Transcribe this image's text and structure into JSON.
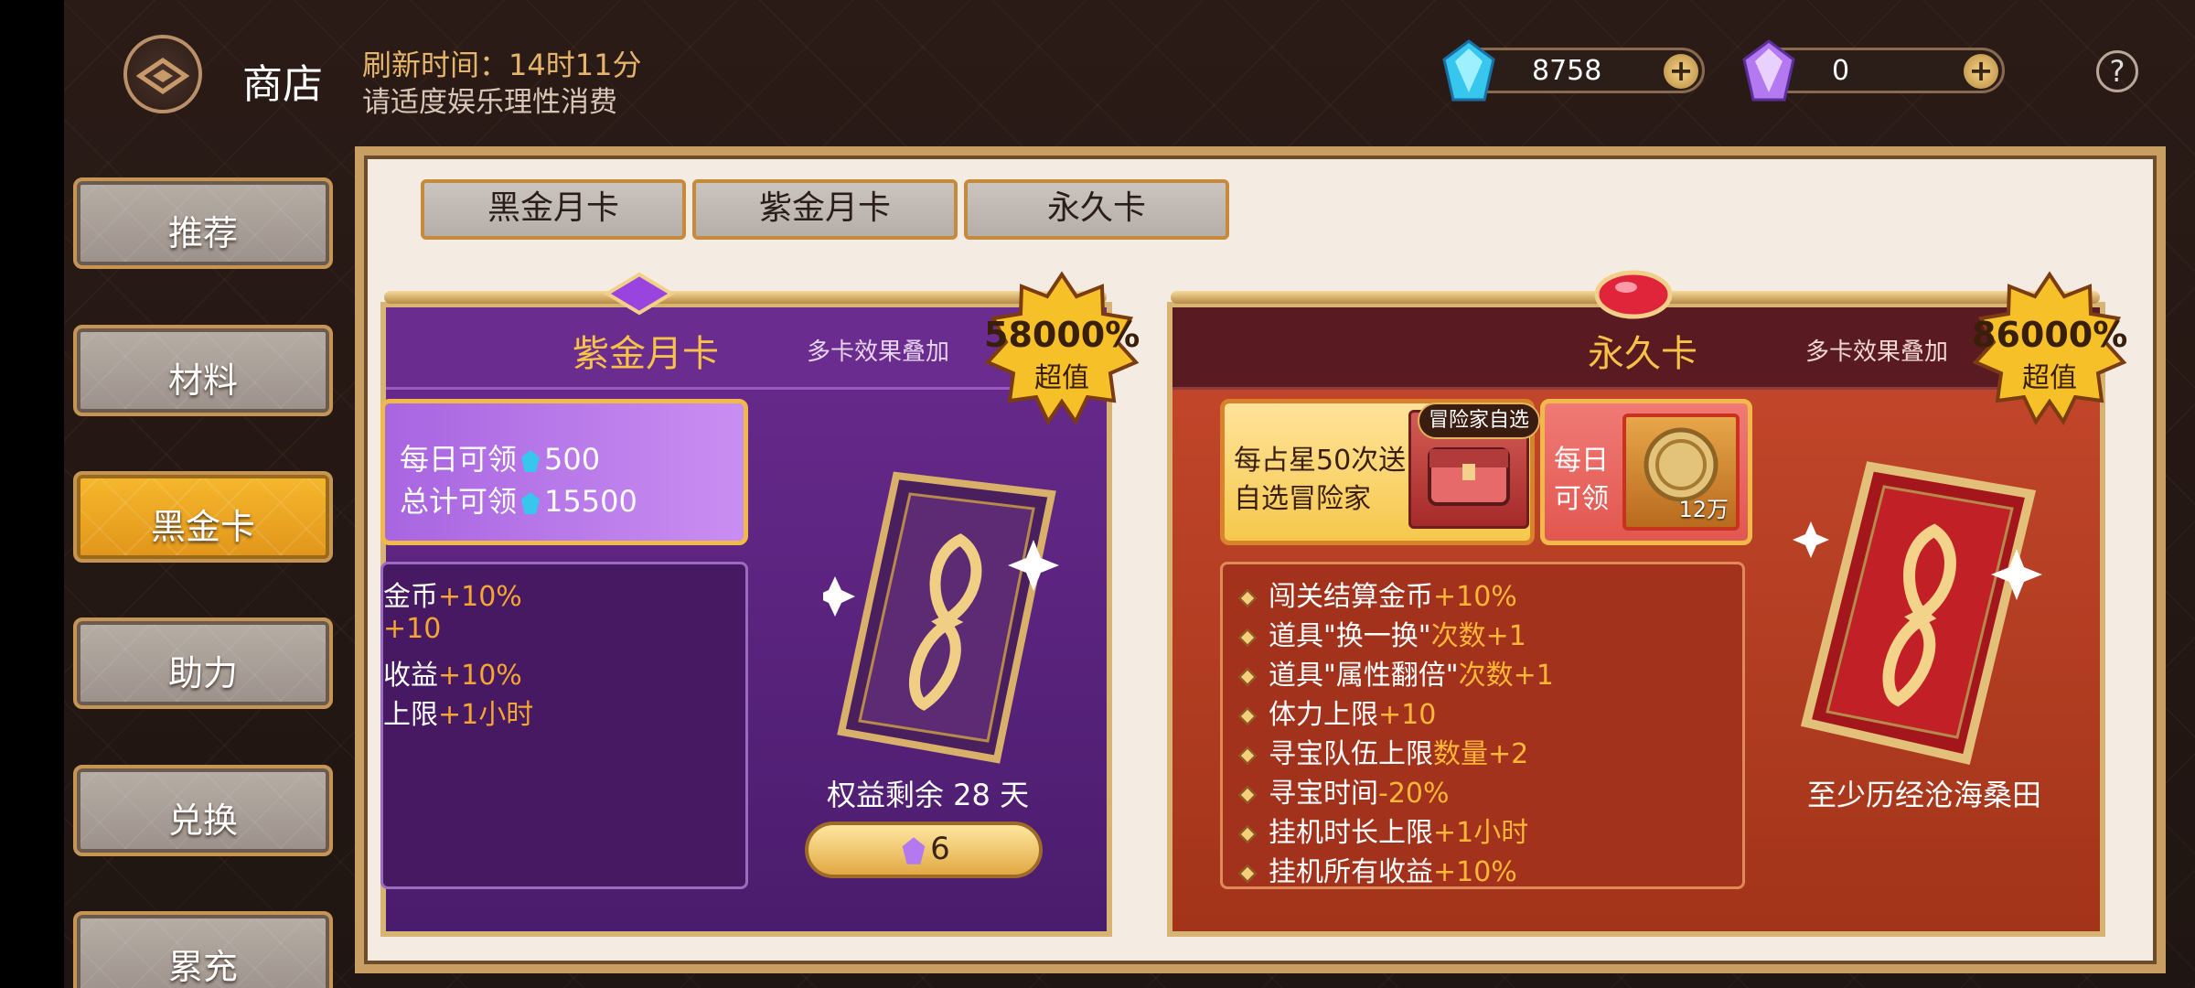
{
  "header": {
    "title": "商店",
    "refresh_time": "刷新时间：14时11分",
    "notice": "请适度娱乐理性消费",
    "currency_blue": "8758",
    "currency_purple": "0",
    "help": "?"
  },
  "sidebar": {
    "items": [
      {
        "label": "推荐"
      },
      {
        "label": "材料"
      },
      {
        "label": "黑金卡"
      },
      {
        "label": "助力"
      },
      {
        "label": "兑换"
      },
      {
        "label": "累充"
      }
    ],
    "active_index": 2
  },
  "tabs": [
    {
      "label": "黑金月卡"
    },
    {
      "label": "紫金月卡"
    },
    {
      "label": "永久卡"
    }
  ],
  "card_purple": {
    "title": "紫金月卡",
    "stack_note": "多卡效果叠加",
    "badge_value": "58000%",
    "badge_label": "超值",
    "daily_label": "每日可领",
    "daily_amount": "500",
    "total_label": "总计可领",
    "total_amount": "15500",
    "benefits": [
      {
        "text": "金币",
        "bonus": "+10%"
      },
      {
        "text": "",
        "bonus": "+10"
      },
      {
        "text": "收益",
        "bonus": "+10%"
      },
      {
        "text": "上限",
        "bonus": "+1小时"
      }
    ],
    "remaining": "权益剩余 28 天",
    "price": "6"
  },
  "card_orange": {
    "title": "永久卡",
    "stack_note": "多卡效果叠加",
    "badge_value": "86000%",
    "badge_label": "超值",
    "reward_line1": "每占星50次送",
    "reward_line2": "自选冒险家",
    "pick_tag": "冒险家自选",
    "daily_line1": "每日",
    "daily_line2": "可领",
    "daily_amount": "12万",
    "benefits": [
      {
        "text": "闯关结算金币",
        "bonus": "+10%"
      },
      {
        "text": "道具\"换一换\"",
        "bonus": "次数+1"
      },
      {
        "text": "道具\"属性翻倍\"",
        "bonus": "次数+1"
      },
      {
        "text": "体力上限",
        "bonus": "+10"
      },
      {
        "text": "寻宝队伍上限",
        "bonus": "数量+2"
      },
      {
        "text": "寻宝时间",
        "bonus": "-20%"
      },
      {
        "text": "挂机时长上限",
        "bonus": "+1小时"
      },
      {
        "text": "挂机所有收益",
        "bonus": "+10%"
      }
    ],
    "condition": "至少历经沧海桑田"
  }
}
